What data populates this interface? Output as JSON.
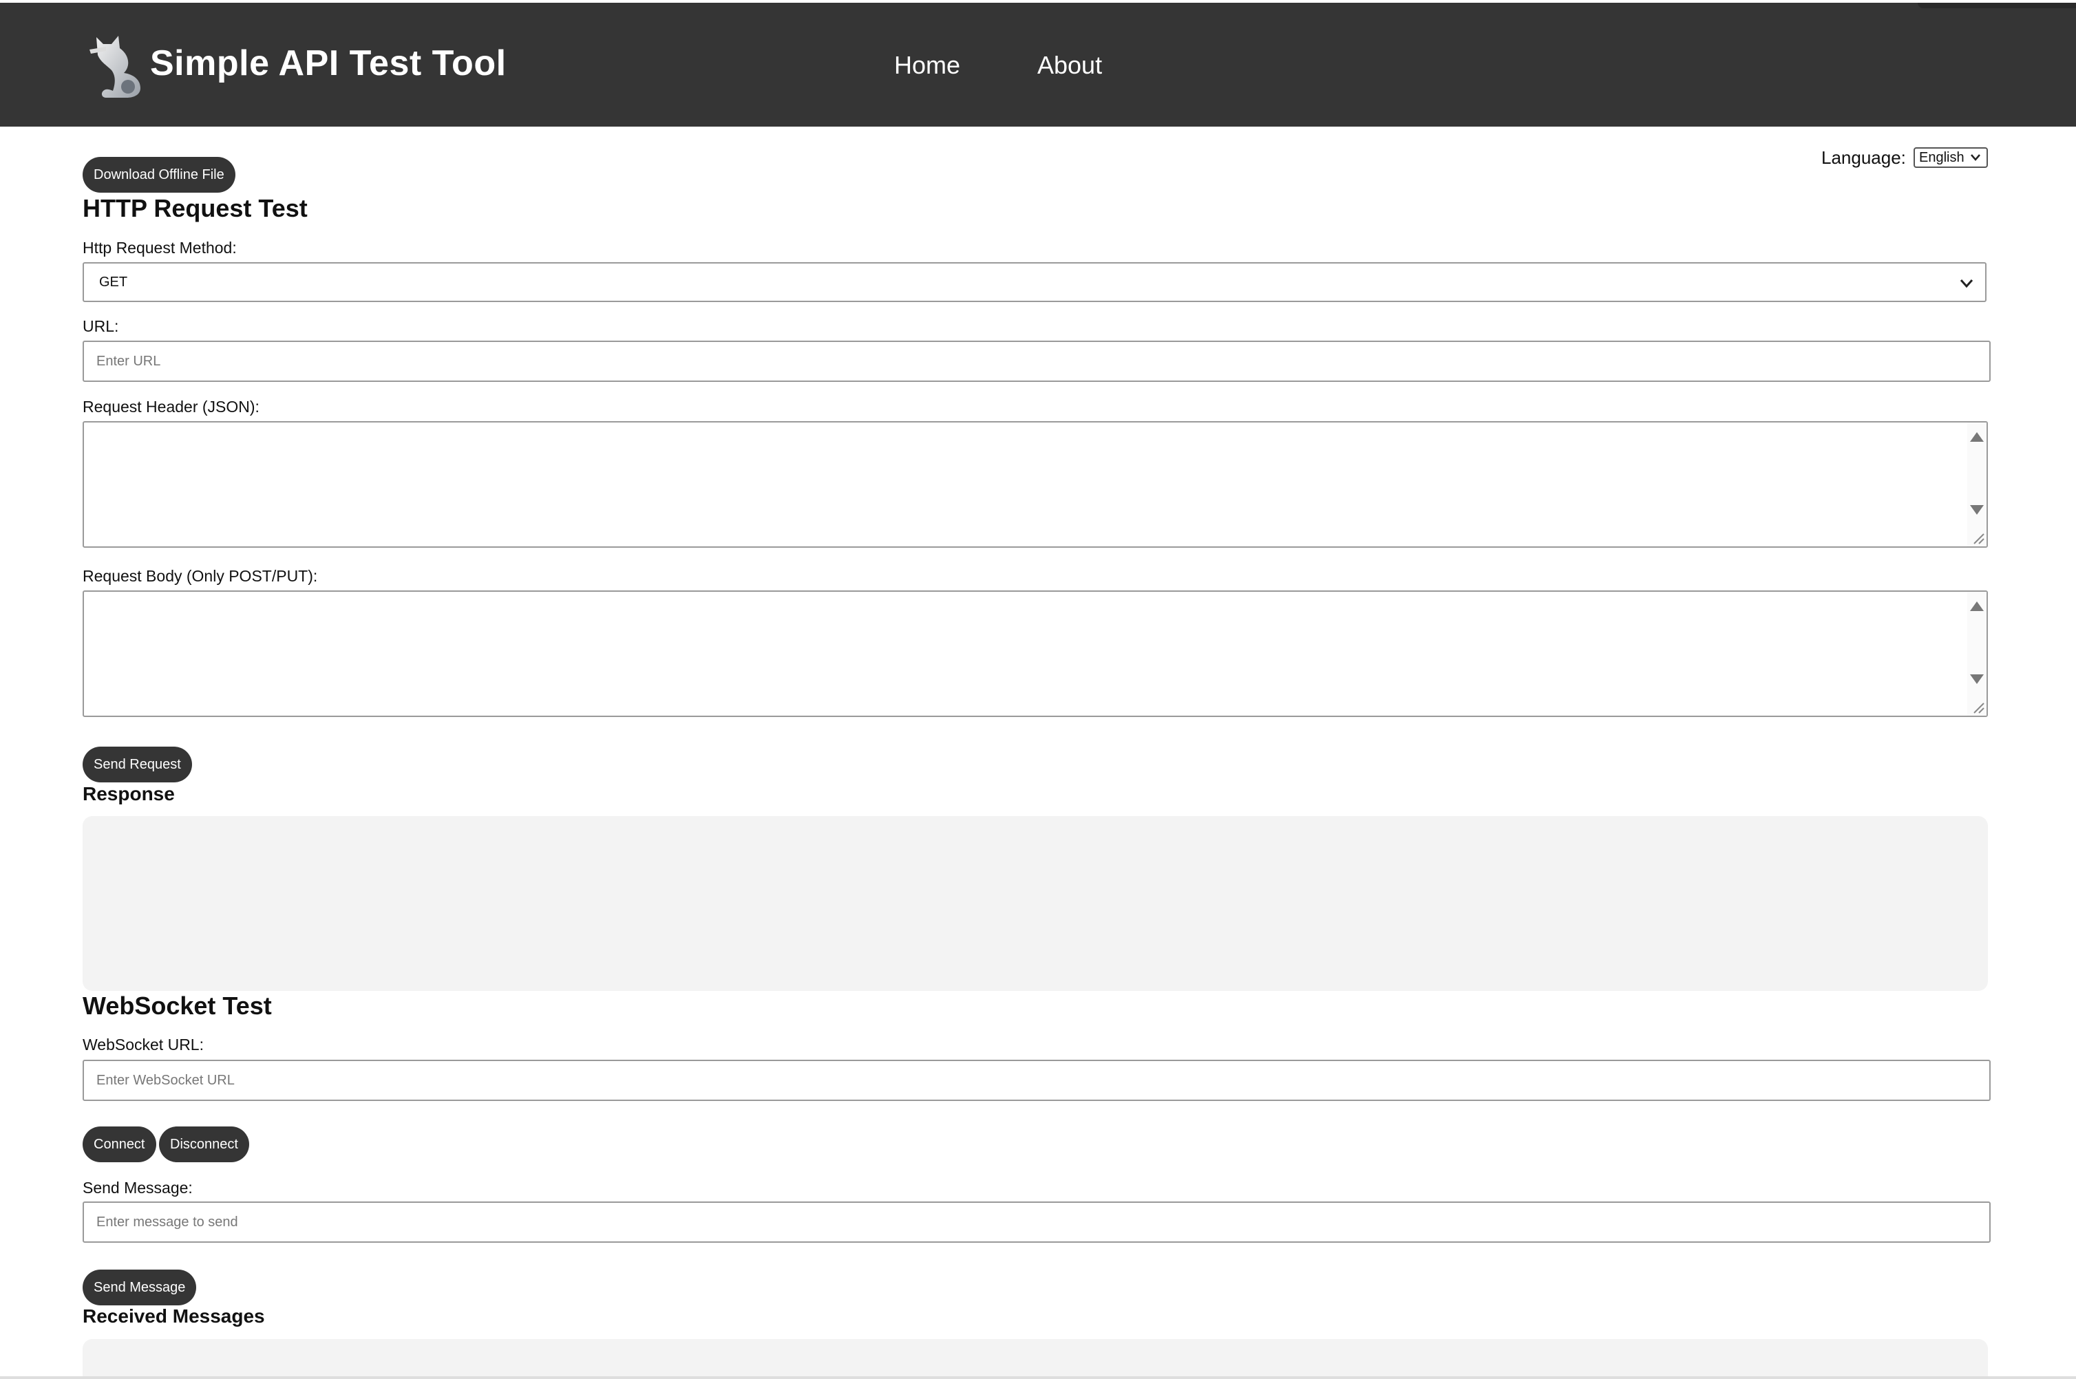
{
  "header": {
    "brand": "Simple API Test Tool",
    "nav": [
      {
        "label": "Home"
      },
      {
        "label": "About"
      }
    ]
  },
  "language": {
    "label": "Language:",
    "selected": "English"
  },
  "download_button": "Download Offline File",
  "http": {
    "title": "HTTP Request Test",
    "method_label": "Http Request Method:",
    "method_value": "GET",
    "url_label": "URL:",
    "url_placeholder": "Enter URL",
    "header_label": "Request Header (JSON):",
    "body_label": "Request Body (Only POST/PUT):",
    "send_button": "Send Request",
    "response_title": "Response"
  },
  "websocket": {
    "title": "WebSocket Test",
    "url_label": "WebSocket URL:",
    "url_placeholder": "Enter WebSocket URL",
    "connect_button": "Connect",
    "disconnect_button": "Disconnect",
    "message_label": "Send Message:",
    "message_placeholder": "Enter message to send",
    "send_button": "Send Message",
    "received_title": "Received Messages"
  },
  "colors": {
    "header_bg": "#353535",
    "button_bg": "#353535",
    "panel_bg": "#f3f3f3"
  },
  "icons": {
    "logo": "cat-logo-icon",
    "select_arrow": "chevron-down-icon"
  }
}
